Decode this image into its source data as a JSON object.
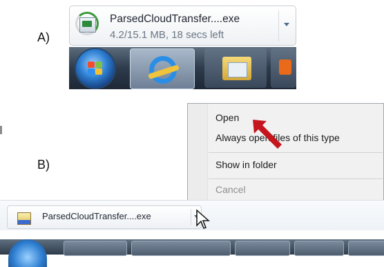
{
  "labels": {
    "a": "A)",
    "b": "B)"
  },
  "download_card": {
    "filename": "ParsedCloudTransfer....exe",
    "status": "4.2/15.1 MB, 18 secs left",
    "progress_fraction": 0.28,
    "icon": "exe-file-icon"
  },
  "context_menu": {
    "items": [
      {
        "label": "Open",
        "enabled": true
      },
      {
        "label": "Always open files of this type",
        "enabled": true
      },
      {
        "label": "Show in folder",
        "enabled": true
      },
      {
        "label": "Cancel",
        "enabled": false
      }
    ]
  },
  "download_shelf": {
    "filename": "ParsedCloudTransfer....exe",
    "icon": "installer-icon"
  },
  "taskbar": {
    "icons": [
      "windows-start-orb",
      "internet-explorer-icon",
      "folder-icon",
      "office-app-icon"
    ]
  },
  "colors": {
    "arrow": "#c4161c",
    "taskbar": "#2d3b4c"
  }
}
